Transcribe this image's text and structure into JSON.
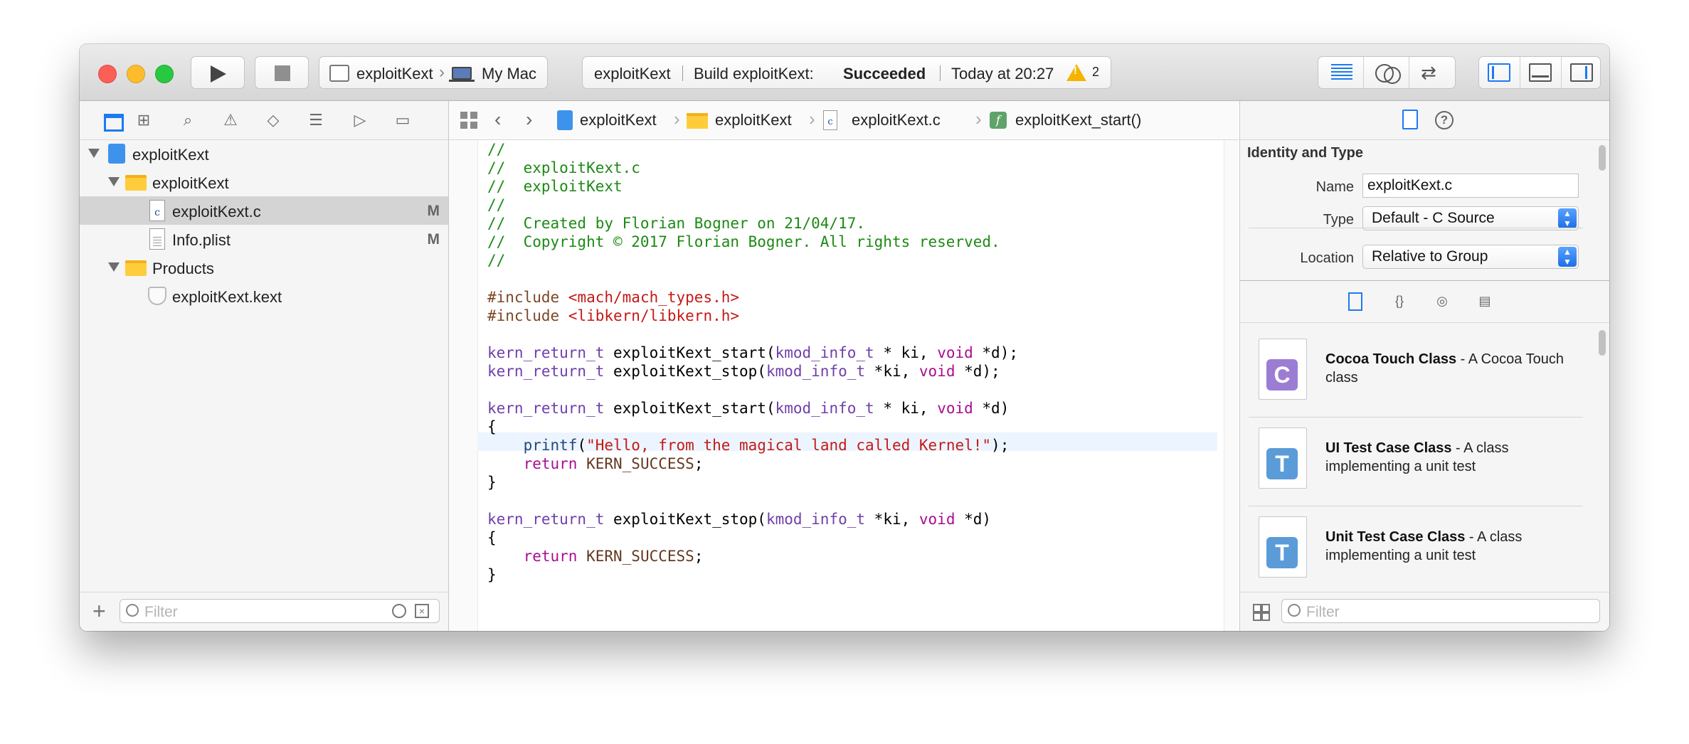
{
  "toolbar": {
    "scheme_target": "exploitKext",
    "scheme_device": "My Mac",
    "status_project": "exploitKext",
    "status_build_prefix": "Build exploitKext:",
    "status_build_result": "Succeeded",
    "status_time": "Today at 20:27",
    "warning_count": "2",
    "icons": [
      "play-icon",
      "stop-icon",
      "standard-editor-icon",
      "assistant-editor-icon",
      "version-editor-icon",
      "navigator-panel-icon",
      "debug-panel-icon",
      "utilities-panel-icon"
    ]
  },
  "navigator": {
    "tabs": [
      "project-navigator-icon",
      "symbol-navigator-icon",
      "find-navigator-icon",
      "issue-navigator-icon",
      "test-navigator-icon",
      "debug-navigator-icon",
      "breakpoint-navigator-icon",
      "report-navigator-icon"
    ],
    "items": [
      {
        "label": "exploitKext",
        "badge": ""
      },
      {
        "label": "exploitKext",
        "badge": ""
      },
      {
        "label": "exploitKext.c",
        "badge": "M"
      },
      {
        "label": "Info.plist",
        "badge": "M"
      },
      {
        "label": "Products",
        "badge": ""
      },
      {
        "label": "exploitKext.kext",
        "badge": ""
      }
    ],
    "filter_placeholder": "Filter"
  },
  "jumpbar": {
    "crumbs": [
      "exploitKext",
      "exploitKext",
      "exploitKext.c",
      "exploitKext_start()"
    ]
  },
  "editor": {
    "lines": [
      "//",
      "//  exploitKext.c",
      "//  exploitKext",
      "//",
      "//  Created by Florian Bogner on 21/04/17.",
      "//  Copyright © 2017 Florian Bogner. All rights reserved.",
      "//",
      "",
      "#include <mach/mach_types.h>",
      "#include <libkern/libkern.h>",
      "",
      "kern_return_t exploitKext_start(kmod_info_t * ki, void *d);",
      "kern_return_t exploitKext_stop(kmod_info_t *ki, void *d);",
      "",
      "kern_return_t exploitKext_start(kmod_info_t * ki, void *d)",
      "{",
      "    printf(\"Hello, from the magical land called Kernel!\");",
      "    return KERN_SUCCESS;",
      "}",
      "",
      "kern_return_t exploitKext_stop(kmod_info_t *ki, void *d)",
      "{",
      "    return KERN_SUCCESS;",
      "}"
    ]
  },
  "inspector": {
    "section_title": "Identity and Type",
    "name_label": "Name",
    "name_value": "exploitKext.c",
    "type_label": "Type",
    "type_value": "Default - C Source",
    "location_label": "Location",
    "location_value": "Relative to Group",
    "library": [
      {
        "title": "Cocoa Touch Class",
        "desc": " - A Cocoa Touch class",
        "letter": "C",
        "color": "#9b7dd4"
      },
      {
        "title": "UI Test Case Class",
        "desc": " - A class implementing a unit test",
        "letter": "T",
        "color": "#5b9bd8"
      },
      {
        "title": "Unit Test Case Class",
        "desc": " - A class implementing a unit test",
        "letter": "T",
        "color": "#5b9bd8"
      }
    ],
    "filter_placeholder": "Filter"
  },
  "colors": {
    "accent": "#1d79f2",
    "comment": "#1c8a14",
    "string": "#c41a16",
    "type": "#6e3fab",
    "keyword": "#aa0d91",
    "warning": "#f5b400"
  }
}
